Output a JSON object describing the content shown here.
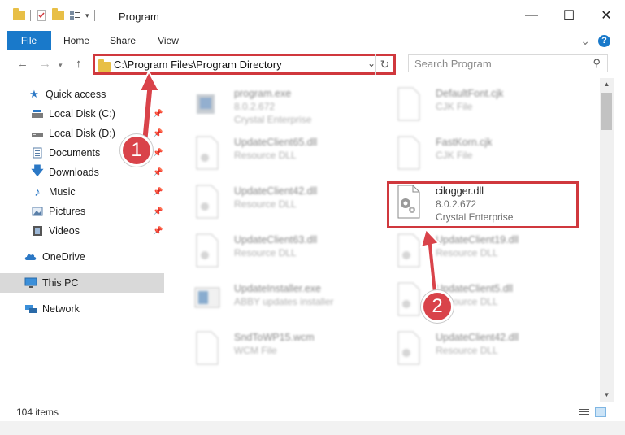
{
  "window": {
    "title": "Program",
    "minimize": "—",
    "maximize": "☐",
    "close": "✕"
  },
  "ribbon": {
    "tabs": [
      "File",
      "Home",
      "Share",
      "View"
    ],
    "expand": "⌄",
    "help": "?"
  },
  "address": {
    "path": "C:\\Program Files\\Program Directory",
    "search_placeholder": "Search Program"
  },
  "sidebar": {
    "items": [
      {
        "label": "Quick access",
        "icon": "star-icon"
      },
      {
        "label": "Local Disk (C:)",
        "icon": "drive-icon"
      },
      {
        "label": "Local Disk (D:)",
        "icon": "drive-icon"
      },
      {
        "label": "Documents",
        "icon": "documents-icon"
      },
      {
        "label": "Downloads",
        "icon": "download-arrow-icon"
      },
      {
        "label": "Music",
        "icon": "music-note-icon"
      },
      {
        "label": "Pictures",
        "icon": "pictures-icon"
      },
      {
        "label": "Videos",
        "icon": "film-icon"
      },
      {
        "label": "OneDrive",
        "icon": "cloud-icon"
      },
      {
        "label": "This PC",
        "icon": "monitor-icon"
      },
      {
        "label": "Network",
        "icon": "network-icon"
      }
    ]
  },
  "files": {
    "left": [
      {
        "name": "program.exe",
        "line1": "8.0.2.672",
        "line2": "Crystal Enterprise"
      },
      {
        "name": "UpdateClient65.dll",
        "line1": "Resource DLL",
        "line2": ""
      },
      {
        "name": "UpdateClient42.dll",
        "line1": "Resource DLL",
        "line2": ""
      },
      {
        "name": "UpdateClient63.dll",
        "line1": "Resource DLL",
        "line2": ""
      },
      {
        "name": "UpdateInstaller.exe",
        "line1": "ABBY updates installer",
        "line2": ""
      },
      {
        "name": "SndToWP15.wcm",
        "line1": "WCM File",
        "line2": ""
      }
    ],
    "right": [
      {
        "name": "DefaultFont.cjk",
        "line1": "CJK File",
        "line2": ""
      },
      {
        "name": "FastKorn.cjk",
        "line1": "CJK File",
        "line2": ""
      },
      {
        "name": "cilogger.dll",
        "line1": "8.0.2.672",
        "line2": "Crystal Enterprise"
      },
      {
        "name": "UpdateClient19.dll",
        "line1": "Resource DLL",
        "line2": ""
      },
      {
        "name": "UpdateClient5.dll",
        "line1": "Resource DLL",
        "line2": ""
      },
      {
        "name": "UpdateClient42.dll",
        "line1": "Resource DLL",
        "line2": ""
      }
    ]
  },
  "status": {
    "count": "104 items"
  },
  "annotations": {
    "step1": "1",
    "step2": "2",
    "color": "#d9434a"
  }
}
